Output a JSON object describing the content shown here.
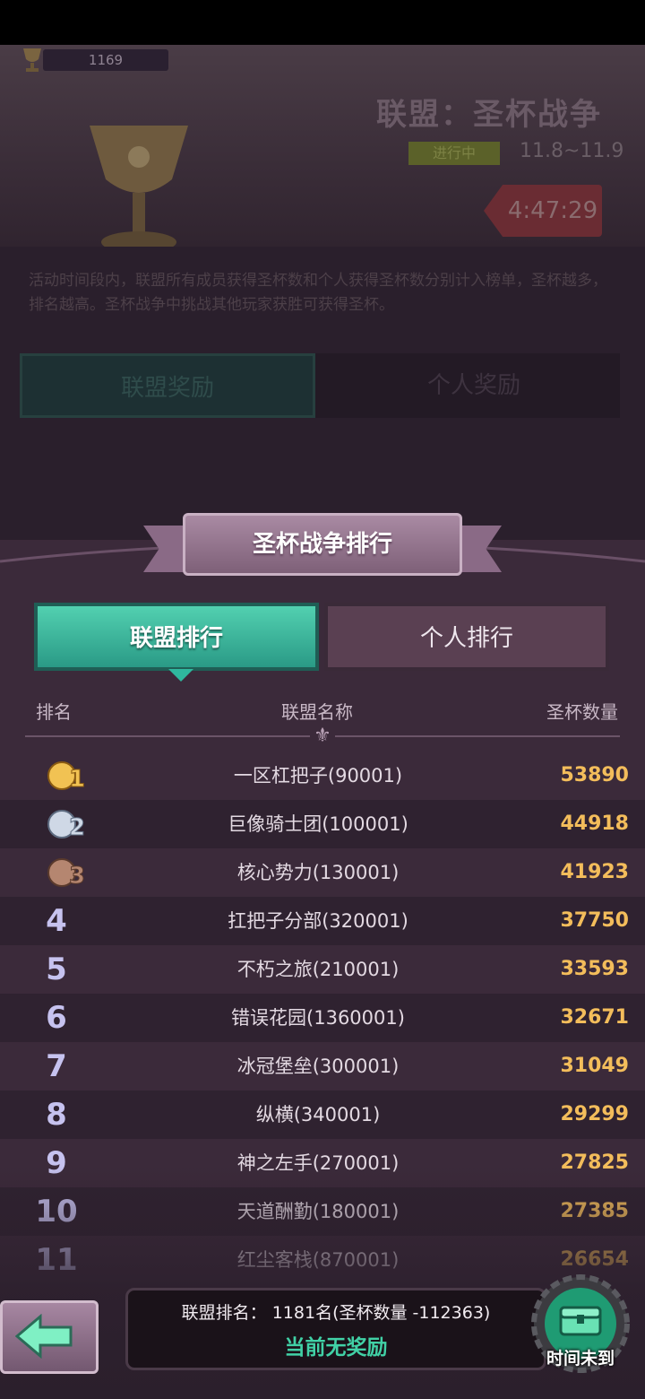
{
  "banner": {
    "trophy_count": "1169",
    "event_title": "联盟：圣杯战争",
    "status_badge": "进行中",
    "dates": "11.8~11.9",
    "timer": "4:47:29"
  },
  "description": "活动时间段内，联盟所有成员获得圣杯数和个人获得圣杯数分别计入榜单，圣杯越多，排名越高。圣杯战争中挑战其他玩家获胜可获得圣杯。",
  "reward_tabs": [
    "联盟奖励",
    "个人奖励"
  ],
  "ranking": {
    "title": "圣杯战争排行",
    "tabs": [
      "联盟排行",
      "个人排行"
    ],
    "columns": [
      "排名",
      "联盟名称",
      "圣杯数量"
    ],
    "rows": [
      {
        "rank": "1",
        "name": "一区杠把子(90001)",
        "score": "53890"
      },
      {
        "rank": "2",
        "name": "巨像骑士团(100001)",
        "score": "44918"
      },
      {
        "rank": "3",
        "name": "核心势力(130001)",
        "score": "41923"
      },
      {
        "rank": "4",
        "name": "扛把子分部(320001)",
        "score": "37750"
      },
      {
        "rank": "5",
        "name": "不朽之旅(210001)",
        "score": "33593"
      },
      {
        "rank": "6",
        "name": "错误花园(1360001)",
        "score": "32671"
      },
      {
        "rank": "7",
        "name": "冰冠堡垒(300001)",
        "score": "31049"
      },
      {
        "rank": "8",
        "name": "纵横(340001)",
        "score": "29299"
      },
      {
        "rank": "9",
        "name": "神之左手(270001)",
        "score": "27825"
      },
      {
        "rank": "10",
        "name": "天道酬勤(180001)",
        "score": "27385"
      },
      {
        "rank": "11",
        "name": "红尘客栈(870001)",
        "score": "26654"
      }
    ]
  },
  "footer": {
    "my_rank": "联盟排名：  1181名(圣杯数量 -112363)",
    "no_reward": "当前无奖励",
    "chest_label": "时间未到"
  },
  "colors": {
    "accent_teal": "#41d1a6",
    "score_gold": "#f3bd5b",
    "rank_lilac": "#c6c2ef"
  }
}
